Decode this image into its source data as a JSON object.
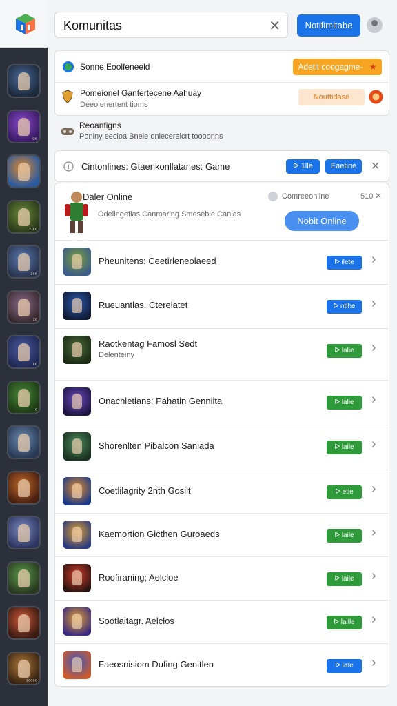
{
  "header": {
    "search_value": "Komunitas",
    "clear_icon": "close-icon",
    "notif_label": "Notifimitabe",
    "avatar_icon": "user-avatar-icon"
  },
  "rail": {
    "items": [
      {
        "cap": "",
        "c1": "#4a6a9a",
        "c2": "#1d2a3c"
      },
      {
        "cap": "ᵢ₂₈",
        "c1": "#8a4ad0",
        "c2": "#3a1b63"
      },
      {
        "cap": "",
        "c1": "#e08a2a",
        "c2": "#2b5aa0"
      },
      {
        "cap": "₂ ₈₀",
        "c1": "#6a8a3a",
        "c2": "#2c3a1a"
      },
      {
        "cap": "₂₉₈",
        "c1": "#5a7ab0",
        "c2": "#2a3550"
      },
      {
        "cap": "₂₈",
        "c1": "#8a6a8a",
        "c2": "#3a2a30"
      },
      {
        "cap": "₉₀",
        "c1": "#4a5aa0",
        "c2": "#202a55"
      },
      {
        "cap": "₀",
        "c1": "#4a8a3a",
        "c2": "#1d3a14"
      },
      {
        "cap": "",
        "c1": "#6a8ab0",
        "c2": "#2a3a55"
      },
      {
        "cap": "",
        "c1": "#c06a2a",
        "c2": "#4a2010"
      },
      {
        "cap": "",
        "c1": "#7a8ac0",
        "c2": "#2e3660"
      },
      {
        "cap": "",
        "c1": "#5a9a4a",
        "c2": "#2a3a20"
      },
      {
        "cap": "",
        "c1": "#d05a3a",
        "c2": "#3a1a12"
      },
      {
        "cap": "₃₀₀₀₀",
        "c1": "#b07a3a",
        "c2": "#3a2412"
      }
    ]
  },
  "notices": {
    "row1_text": "Sonne Eoolfeneeld",
    "row1_button": "Adetit coogagme-",
    "row2_title": "Pomeionel Gantertecene Aahuay",
    "row2_sub": "Deeolenertent tioms",
    "row2_button": "Nouttidase",
    "row3_title": "Reoanfigns",
    "row3_sub": "Poniny eecioa Bnele onlecereicrt toooonns"
  },
  "filter": {
    "label": "Cintonlines: Gtaenkonllatanes: Game",
    "btn1": "ᐅ 1lle",
    "btn2": "Eaetine"
  },
  "featured": {
    "title": "Daler Online",
    "status_text": "Comreeonline",
    "count": "510",
    "desc": "Odelingefias Canmaring Smeseble Canias",
    "cta": "Nobit Online"
  },
  "games": [
    {
      "title": "Pheunitens: Ceetirleneolaeed",
      "sub": "",
      "btn": "ᐅ ilete",
      "btn_color": "#1a73e8",
      "c1": "#7aa03a",
      "c2": "#3a5a8a"
    },
    {
      "title": "Rueuantlas. Cterelatet",
      "sub": "",
      "btn": "ᐅ ntlhe",
      "btn_color": "#1a73e8",
      "c1": "#2a5ab0",
      "c2": "#101a33"
    },
    {
      "title": "Raotkentag Famosl Sedt",
      "sub": "Delenteiny",
      "btn": "ᐅ lalie",
      "btn_color": "#2e9a3a",
      "c1": "#4a6a3a",
      "c2": "#1a2a14"
    },
    {
      "title": "Onachletians; Pahatin Genniita",
      "sub": "",
      "btn": "ᐅ lalie",
      "btn_color": "#2e9a3a",
      "c1": "#6a4ac0",
      "c2": "#1d1440"
    },
    {
      "title": "Shorenlten Pibalcon Sanlada",
      "sub": "",
      "btn": "ᐅ laile",
      "btn_color": "#2e9a3a",
      "c1": "#4a8a5a",
      "c2": "#1a3020"
    },
    {
      "title": "Coetlilagrity 2nth Gosilt",
      "sub": "",
      "btn": "ᐅ etie",
      "btn_color": "#2e9a3a",
      "c1": "#e08a2a",
      "c2": "#1a3a8a"
    },
    {
      "title": "Kaemortion Gicthen Guroaeds",
      "sub": "",
      "btn": "ᐅ laile",
      "btn_color": "#2e9a3a",
      "c1": "#e0a030",
      "c2": "#2a3a80"
    },
    {
      "title": "Roofiraning; Aelcloe",
      "sub": "",
      "btn": "ᐅ laile",
      "btn_color": "#2e9a3a",
      "c1": "#d03a2a",
      "c2": "#2a1410"
    },
    {
      "title": "Sootlaitagr. Aelclos",
      "sub": "",
      "btn": "ᐅ laille",
      "btn_color": "#2e9a3a",
      "c1": "#e0a030",
      "c2": "#3a2a80"
    },
    {
      "title": "Faeosnisiom  Dufing Genitlen",
      "sub": "",
      "btn": "ᐅ lafe",
      "btn_color": "#1a73e8",
      "c1": "#3a5ac0",
      "c2": "#d05a2a"
    }
  ]
}
